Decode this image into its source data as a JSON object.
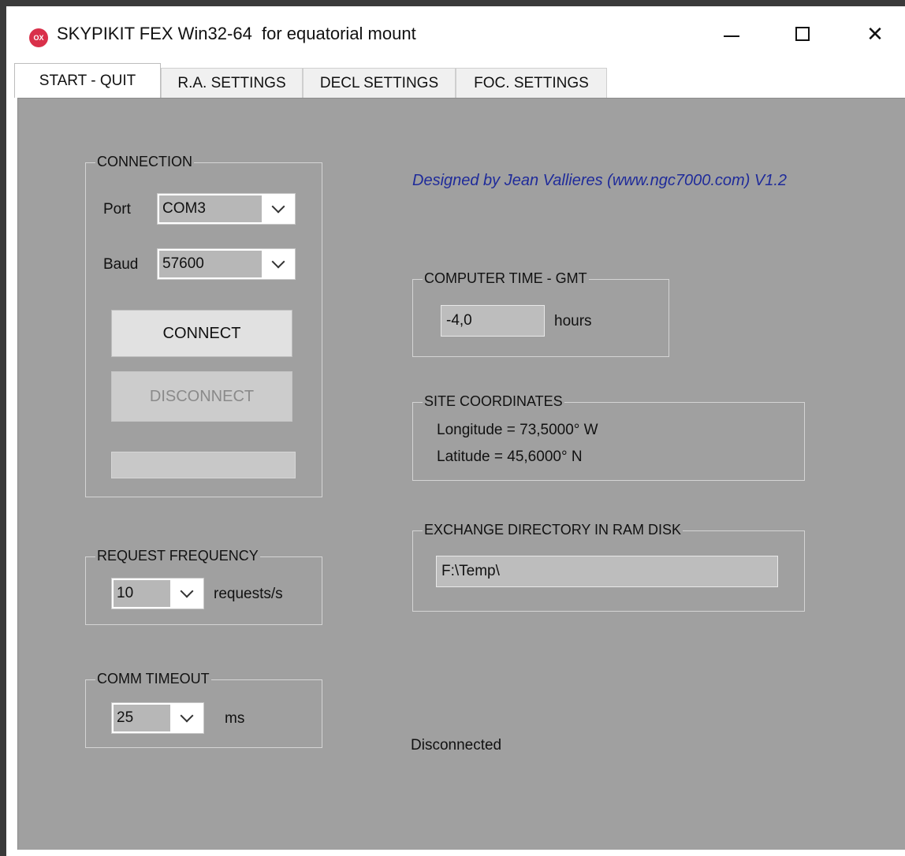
{
  "window": {
    "title": "SKYPIKIT FEX Win32-64  for equatorial mount",
    "app_icon_text": "OX",
    "app_icon_color": "#d9304a"
  },
  "tabs": [
    {
      "label": "START - QUIT",
      "active": true
    },
    {
      "label": "R.A. SETTINGS",
      "active": false
    },
    {
      "label": "DECL SETTINGS",
      "active": false
    },
    {
      "label": "FOC. SETTINGS",
      "active": false
    }
  ],
  "connection": {
    "group_label": "CONNECTION",
    "port_label": "Port",
    "port_value": "COM3",
    "baud_label": "Baud",
    "baud_value": "57600",
    "connect_label": "CONNECT",
    "disconnect_label": "DISCONNECT",
    "progress_value": ""
  },
  "request_frequency": {
    "group_label": "REQUEST FREQUENCY",
    "value": "10",
    "unit": "requests/s"
  },
  "comm_timeout": {
    "group_label": "COMM TIMEOUT",
    "value": "25",
    "unit": "ms"
  },
  "credit": "Designed by Jean Vallieres   (www.ngc7000.com)  V1.2",
  "computer_time": {
    "group_label": "COMPUTER TIME - GMT",
    "value": "-4,0",
    "unit": "hours"
  },
  "site": {
    "group_label": "SITE COORDINATES",
    "longitude": "Longitude = 73,5000° W",
    "latitude": "Latitude = 45,6000° N"
  },
  "exchange": {
    "group_label": "EXCHANGE DIRECTORY IN RAM DISK",
    "path": "F:\\Temp\\"
  },
  "status": "Disconnected",
  "colors": {
    "panel": "#a0a0a0",
    "credit_text": "#1f2b9a"
  }
}
